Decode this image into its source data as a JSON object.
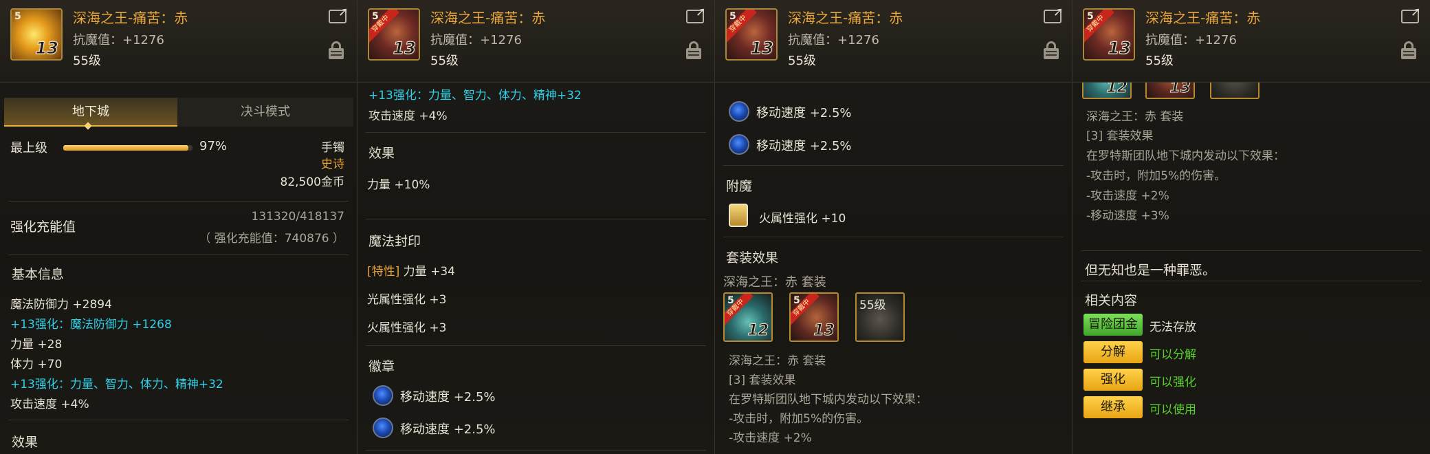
{
  "header": {
    "title": "深海之王-痛苦：赤",
    "stat": "抗魔值：+1276",
    "level": "55级",
    "icon_top_left": "5",
    "icon_level": "13",
    "icon_ribbon": "穿戴中"
  },
  "panel1": {
    "tabs": [
      "地下城",
      "决斗模式"
    ],
    "grade_label": "最上级",
    "grade_percent_text": "97%",
    "grade_percent": 0.97,
    "slot_type": "手镯",
    "rarity": "史诗",
    "price": "82,500金币",
    "charge_label": "强化充能值",
    "charge_value": "131320/418137",
    "charge_sub": "（ 强化充能值：740876 ）",
    "basic_title": "基本信息",
    "lines": [
      {
        "text": "魔法防御力 +2894",
        "color": "white"
      },
      {
        "text": "+13强化：魔法防御力 +1268",
        "color": "cyan"
      },
      {
        "text": "力量 +28",
        "color": "white"
      },
      {
        "text": "体力 +70",
        "color": "white"
      },
      {
        "text": "+13强化：力量、智力、体力、精神+32",
        "color": "cyan"
      },
      {
        "text": "攻击速度 +4%",
        "color": "white"
      }
    ],
    "effect_title": "效果"
  },
  "panel2": {
    "enh_line": "+13强化：力量、智力、体力、精神+32",
    "attack_speed": "攻击速度 +4%",
    "effect_title": "效果",
    "effect_value": "力量 +10%",
    "seal_title": "魔法封印",
    "seal_tag": "[特性]",
    "seal_tag_value": " 力量 +34",
    "seal_lines": [
      "光属性强化 +3",
      "火属性强化 +3"
    ],
    "emblem_title": "徽章",
    "emblems": [
      "移动速度 +2.5%",
      "移动速度 +2.5%"
    ]
  },
  "panel3": {
    "emblems": [
      "移动速度 +2.5%",
      "移动速度 +2.5%"
    ],
    "enchant_title": "附魔",
    "enchant_value": "火属性强化 +10",
    "set_title": "套装效果",
    "set_name": "深海之王：赤 套装",
    "slot_levels": [
      "12",
      "13"
    ],
    "slot_level_text": "55级",
    "set_name2": "深海之王：赤  套装",
    "set_effect_title": "[3] 套装效果",
    "set_effect_lines": [
      "在罗特斯团队地下城内发动以下效果：",
      "-攻击时，附加5%的伤害。",
      "-攻击速度 +2%"
    ]
  },
  "panel4": {
    "thumb_levels": [
      "12",
      "13"
    ],
    "set_name": "深海之王：赤  套装",
    "set_effect_title": "[3] 套装效果",
    "set_effect_lines": [
      "在罗特斯团队地下城内发动以下效果：",
      "-攻击时，附加5%的伤害。",
      "-攻击速度 +2%",
      "-移动速度 +3%"
    ],
    "flavor": "但无知也是一种罪恶。",
    "related_title": "相关内容",
    "actions": [
      {
        "button": "冒险团金库",
        "status": "无法存放",
        "button_color": "green",
        "status_color": "white"
      },
      {
        "button": "分解",
        "status": "可以分解",
        "button_color": "yellow",
        "status_color": "green"
      },
      {
        "button": "强化",
        "status": "可以强化",
        "button_color": "yellow",
        "status_color": "green"
      },
      {
        "button": "继承",
        "status": "可以使用",
        "button_color": "yellow",
        "status_color": "green"
      }
    ]
  }
}
